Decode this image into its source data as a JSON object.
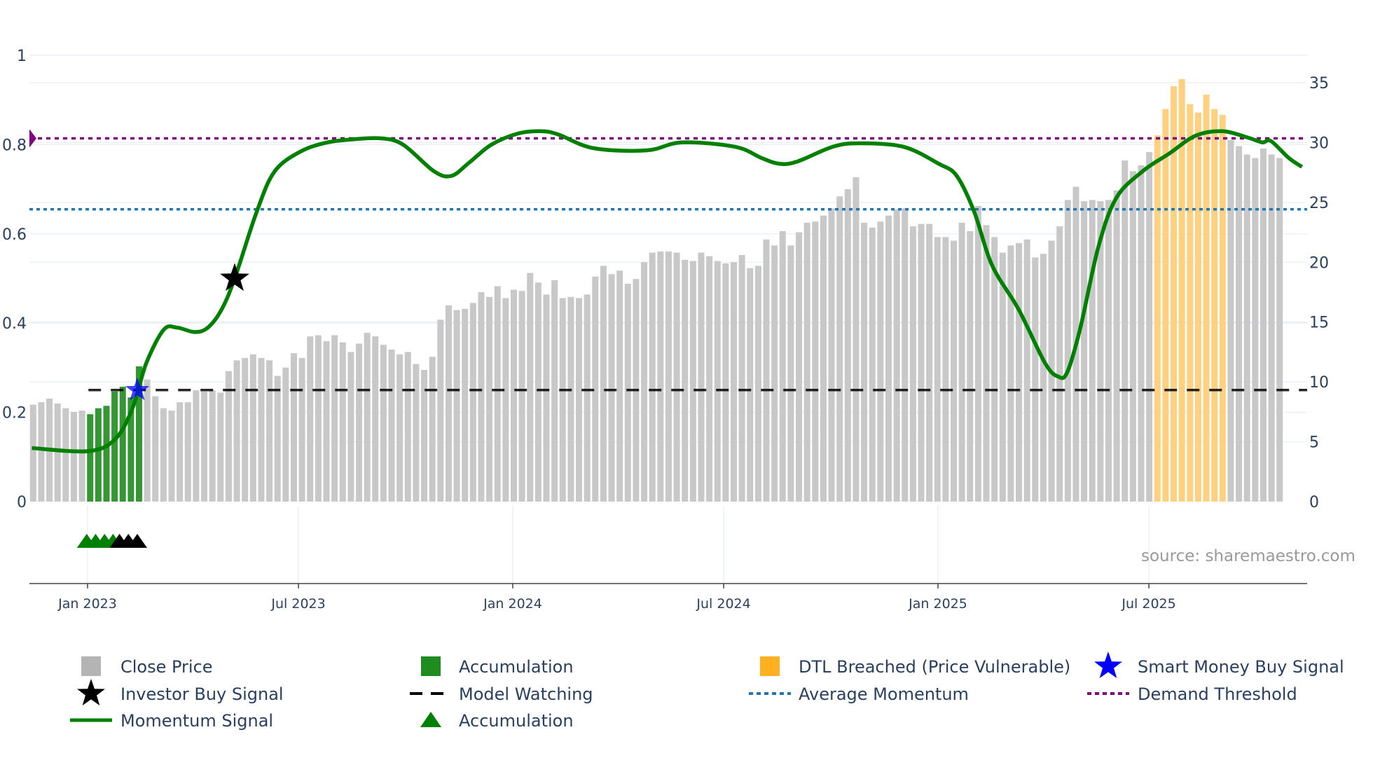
{
  "chart_data": {
    "type": "bar",
    "title": "",
    "x_unit": "decimal year",
    "source_note": "source: sharemaestro.com",
    "left_axis": {
      "range": [
        0,
        1
      ],
      "ticks": [
        {
          "v": 0,
          "label": "0"
        },
        {
          "v": 0.2,
          "label": "0.2"
        },
        {
          "v": 0.4,
          "label": "0.4"
        },
        {
          "v": 0.6,
          "label": "0.6"
        },
        {
          "v": 0.8,
          "label": "0.8"
        },
        {
          "v": 1,
          "label": "1"
        }
      ]
    },
    "right_axis": {
      "range": [
        0,
        37.3
      ],
      "ticks": [
        {
          "v": 0,
          "label": "0"
        },
        {
          "v": 5,
          "label": "5"
        },
        {
          "v": 10,
          "label": "10"
        },
        {
          "v": 15,
          "label": "15"
        },
        {
          "v": 20,
          "label": "20"
        },
        {
          "v": 25,
          "label": "25"
        },
        {
          "v": 30,
          "label": "30"
        },
        {
          "v": 35,
          "label": "35"
        }
      ]
    },
    "x_axis": {
      "range": [
        2022.86,
        2025.87
      ],
      "ticks": [
        {
          "v": 2023.0,
          "label": "Jan 2023"
        },
        {
          "v": 2023.496,
          "label": "Jul 2023"
        },
        {
          "v": 2024.0,
          "label": "Jan 2024"
        },
        {
          "v": 2024.496,
          "label": "Jul 2024"
        },
        {
          "v": 2025.0,
          "label": "Jan 2025"
        },
        {
          "v": 2025.496,
          "label": "Jul 2025"
        }
      ]
    },
    "close_price": {
      "start_year": 2022.872,
      "step_years": 0.01916,
      "values": [
        8.1,
        8.3,
        8.6,
        8.2,
        7.8,
        7.5,
        7.6,
        7.3,
        7.8,
        8.0,
        9.2,
        9.6,
        8.7,
        11.3,
        10.2,
        8.8,
        7.8,
        7.6,
        8.3,
        8.3,
        9.3,
        9.2,
        9.3,
        9.1,
        10.9,
        11.8,
        12.0,
        12.3,
        12.0,
        11.8,
        10.5,
        11.2,
        12.4,
        12.0,
        13.8,
        13.9,
        13.4,
        13.9,
        13.3,
        12.5,
        13.2,
        14.1,
        13.8,
        13.1,
        12.7,
        12.3,
        12.5,
        11.5,
        11.0,
        12.1,
        15.2,
        16.4,
        16.0,
        16.1,
        16.6,
        17.5,
        17.1,
        18.0,
        17.0,
        17.7,
        17.6,
        19.1,
        18.3,
        17.3,
        18.5,
        17.0,
        17.1,
        17.0,
        17.3,
        18.8,
        19.7,
        19.0,
        19.3,
        18.2,
        18.6,
        20.0,
        20.8,
        20.9,
        20.9,
        20.8,
        20.2,
        20.1,
        20.8,
        20.5,
        20.1,
        19.9,
        20.0,
        20.6,
        19.5,
        19.7,
        21.9,
        21.4,
        22.6,
        21.4,
        22.5,
        23.3,
        23.4,
        23.9,
        24.5,
        25.5,
        26.1,
        27.1,
        23.3,
        22.9,
        23.4,
        23.9,
        24.4,
        24.5,
        23.0,
        23.2,
        23.2,
        22.1,
        22.1,
        21.8,
        23.3,
        22.6,
        24.7,
        23.1,
        22.1,
        20.8,
        21.4,
        21.6,
        21.9,
        20.4,
        20.7,
        21.8,
        23.0,
        25.2,
        26.3,
        25.1,
        25.2,
        25.1,
        25.2,
        26.0,
        28.5,
        27.6,
        28.1,
        29.2,
        30.6,
        32.8,
        34.7,
        35.3,
        33.2,
        32.5,
        34.0,
        32.8,
        32.3,
        30.2,
        29.7,
        29.0,
        28.7,
        29.5,
        29.0,
        28.7
      ],
      "accumulation_indices": [
        7,
        8,
        9,
        10,
        11,
        12,
        13
      ],
      "dtl_breached_indices": [
        138,
        139,
        140,
        141,
        142,
        143,
        144,
        145,
        146
      ]
    },
    "momentum_signal": [
      [
        2022.869,
        0.12
      ],
      [
        2023.002,
        0.113
      ],
      [
        2023.065,
        0.14
      ],
      [
        2023.106,
        0.21
      ],
      [
        2023.138,
        0.31
      ],
      [
        2023.179,
        0.385
      ],
      [
        2023.21,
        0.39
      ],
      [
        2023.252,
        0.38
      ],
      [
        2023.283,
        0.39
      ],
      [
        2023.315,
        0.43
      ],
      [
        2023.346,
        0.5
      ],
      [
        2023.398,
        0.65
      ],
      [
        2023.44,
        0.74
      ],
      [
        2023.502,
        0.785
      ],
      [
        2023.565,
        0.805
      ],
      [
        2023.627,
        0.812
      ],
      [
        2023.69,
        0.814
      ],
      [
        2023.742,
        0.8
      ],
      [
        2023.815,
        0.74
      ],
      [
        2023.856,
        0.73
      ],
      [
        2023.898,
        0.76
      ],
      [
        2023.95,
        0.8
      ],
      [
        2024.013,
        0.825
      ],
      [
        2024.065,
        0.83
      ],
      [
        2024.106,
        0.823
      ],
      [
        2024.19,
        0.792
      ],
      [
        2024.315,
        0.787
      ],
      [
        2024.398,
        0.805
      ],
      [
        2024.523,
        0.795
      ],
      [
        2024.585,
        0.77
      ],
      [
        2024.627,
        0.757
      ],
      [
        2024.669,
        0.762
      ],
      [
        2024.752,
        0.795
      ],
      [
        2024.815,
        0.803
      ],
      [
        2024.919,
        0.795
      ],
      [
        2025.002,
        0.757
      ],
      [
        2025.044,
        0.73
      ],
      [
        2025.085,
        0.65
      ],
      [
        2025.127,
        0.53
      ],
      [
        2025.19,
        0.43
      ],
      [
        2025.252,
        0.31
      ],
      [
        2025.283,
        0.28
      ],
      [
        2025.304,
        0.29
      ],
      [
        2025.335,
        0.39
      ],
      [
        2025.377,
        0.57
      ],
      [
        2025.419,
        0.68
      ],
      [
        2025.481,
        0.74
      ],
      [
        2025.544,
        0.78
      ],
      [
        2025.606,
        0.82
      ],
      [
        2025.669,
        0.83
      ],
      [
        2025.731,
        0.815
      ],
      [
        2025.763,
        0.805
      ],
      [
        2025.783,
        0.808
      ],
      [
        2025.825,
        0.77
      ],
      [
        2025.856,
        0.75
      ]
    ],
    "model_watching": {
      "value": 0.25,
      "from": 2023.002
    },
    "average_momentum": 0.655,
    "demand_threshold": 0.814,
    "investor_buy_signals": [
      [
        2023.346,
        0.5
      ]
    ],
    "smart_money_buy_signals": [
      [
        2023.117,
        0.25
      ]
    ],
    "accumulation_triangles": [
      2022.998,
      2023.019,
      2023.04,
      2023.06
    ],
    "watching_triangles": [
      2023.075,
      2023.096,
      2023.117
    ],
    "colors": {
      "close": "#c8c8c8",
      "accumulation": "#1e8c1e",
      "dtl": "#ffd080",
      "momentum": "#008000",
      "avg": "#1f77b4",
      "threshold": "#800080",
      "watching": "#000000",
      "smart": "#0000ff"
    }
  },
  "legend": [
    {
      "label": "Close Price",
      "marker": "square-grey"
    },
    {
      "label": "Accumulation",
      "marker": "square-green"
    },
    {
      "label": "DTL Breached (Price Vulnerable)",
      "marker": "square-orange"
    },
    {
      "label": "Smart Money Buy Signal",
      "marker": "star-blue"
    },
    {
      "label": "Investor Buy Signal",
      "marker": "star-black"
    },
    {
      "label": "Model Watching",
      "marker": "dash-black"
    },
    {
      "label": "Average Momentum",
      "marker": "dot-blue"
    },
    {
      "label": "Demand Threshold",
      "marker": "dot-purple"
    },
    {
      "label": "Momentum Signal",
      "marker": "line-green"
    },
    {
      "label": "Accumulation",
      "marker": "triangle-green"
    }
  ]
}
